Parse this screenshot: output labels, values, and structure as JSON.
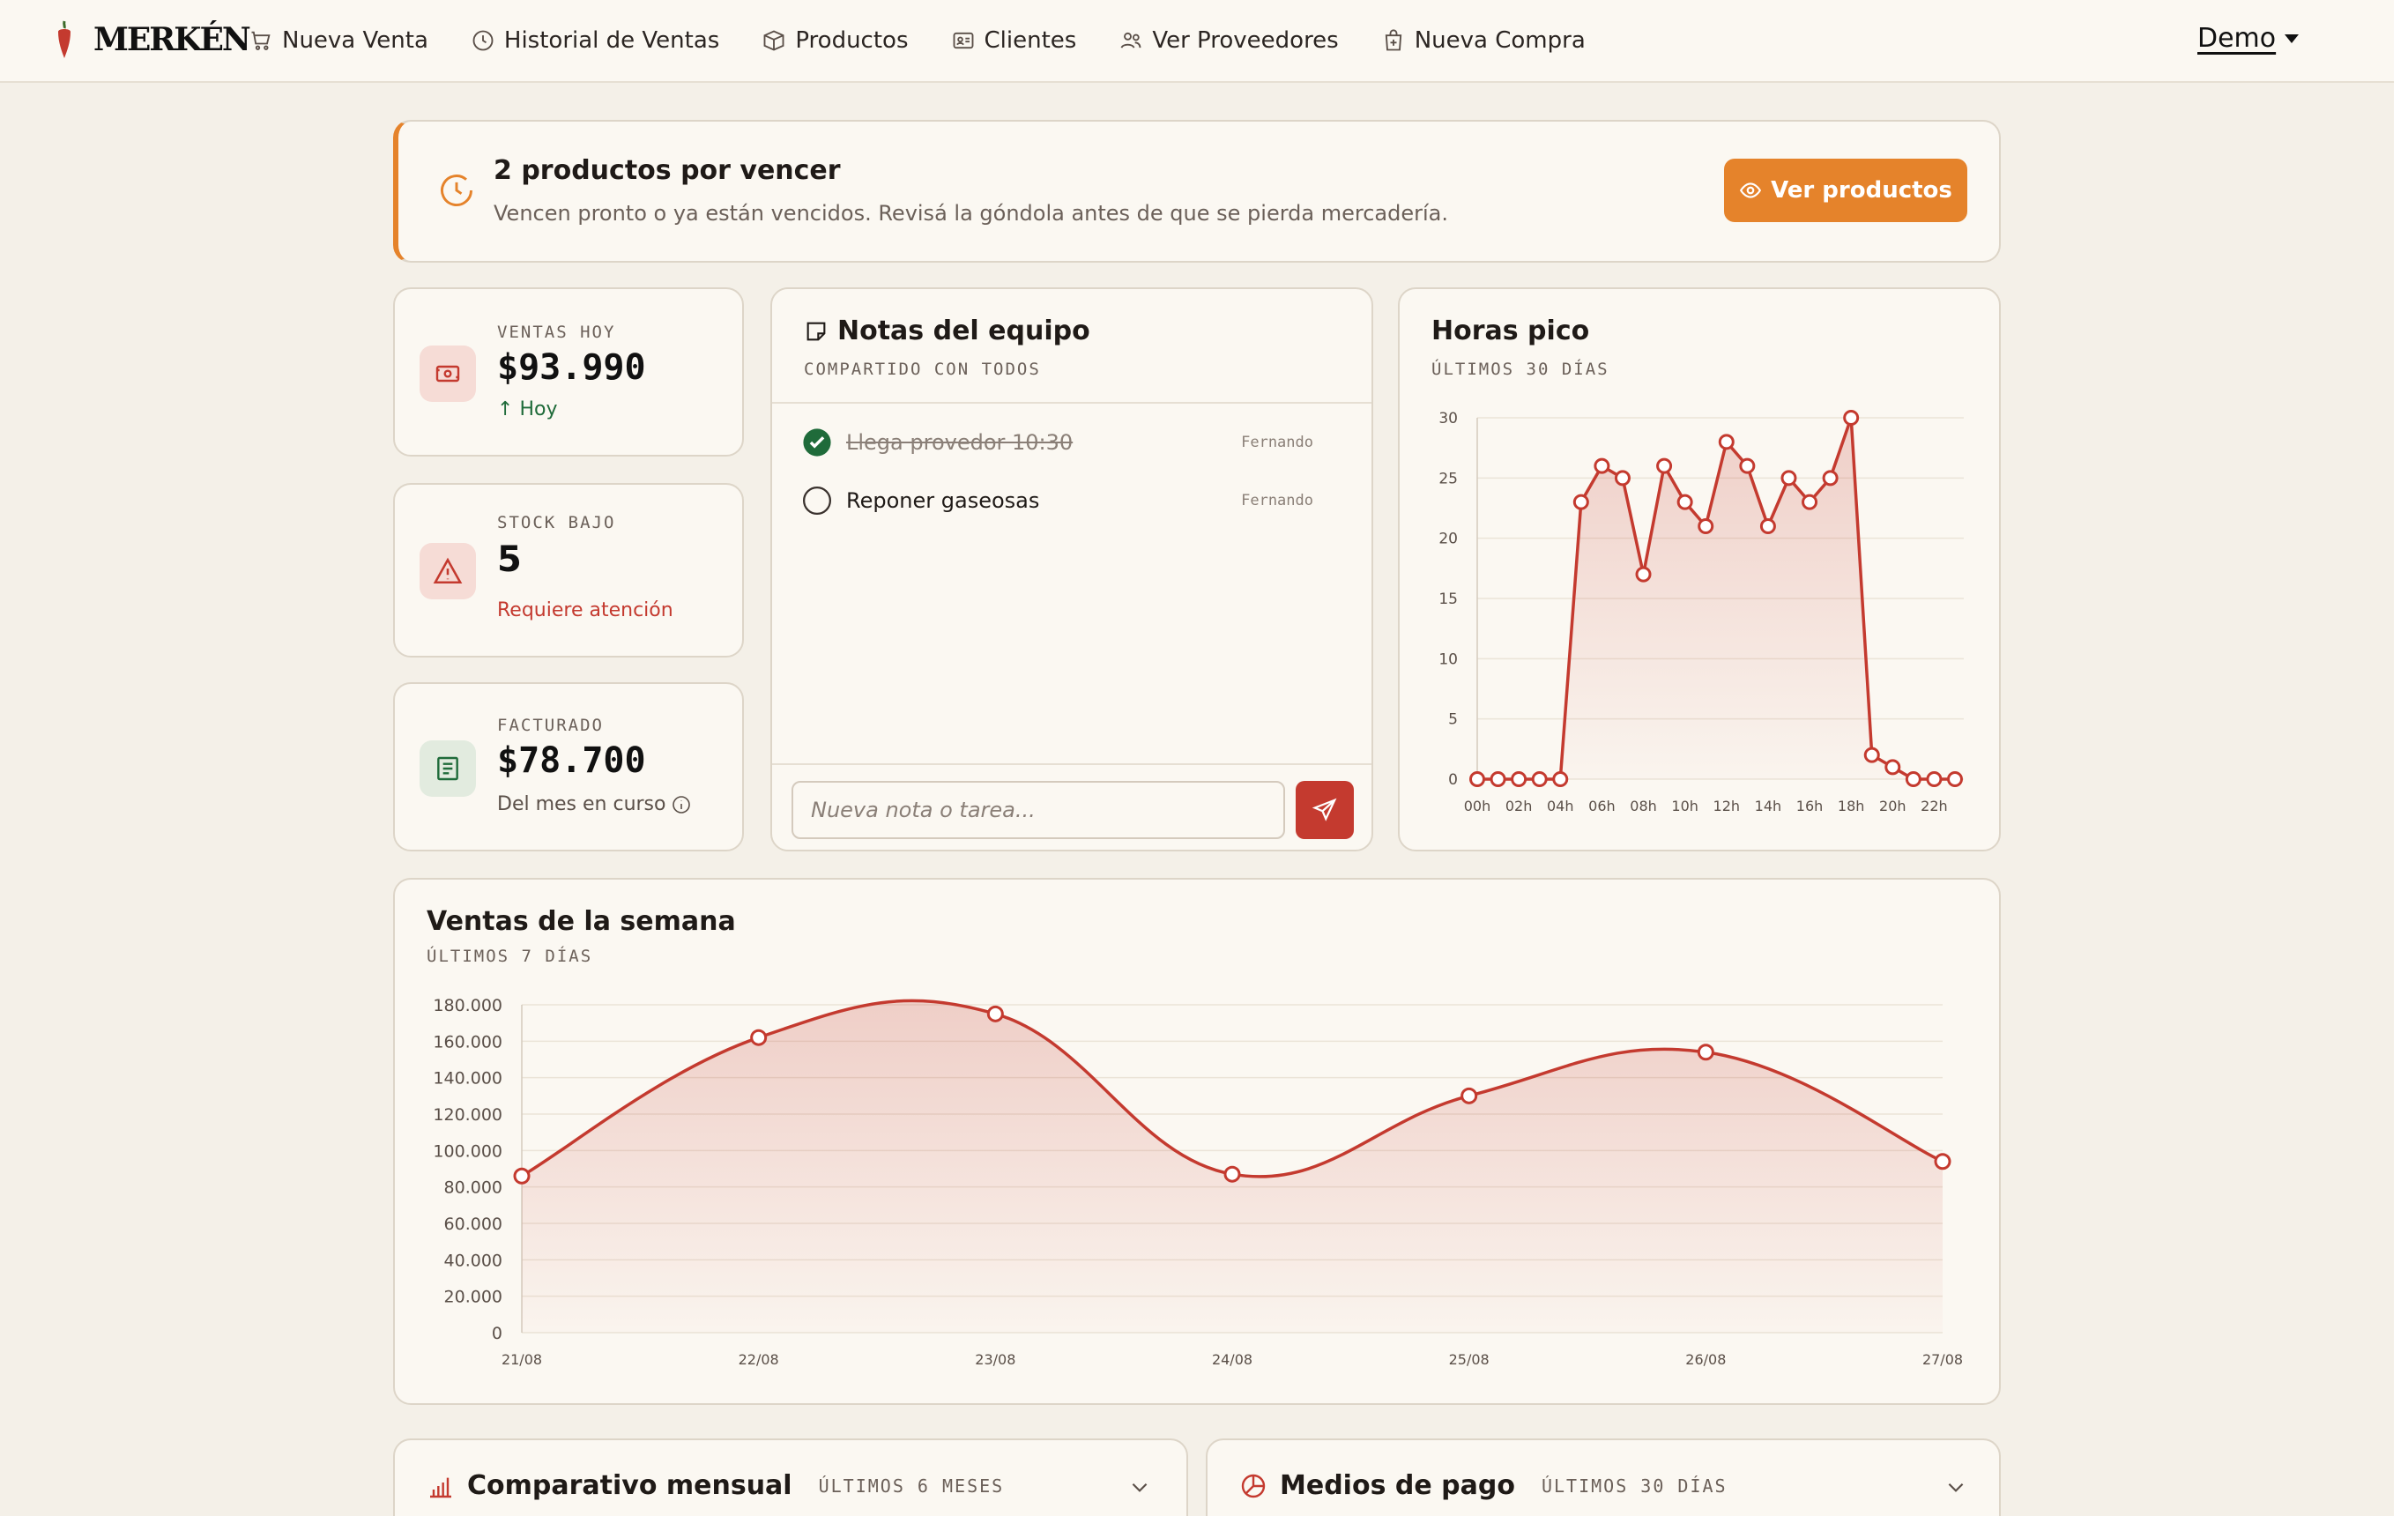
{
  "app": {
    "brand": "MERKÉN",
    "user": "Demo"
  },
  "nav": [
    {
      "label": "Nueva Venta",
      "icon": "cart-icon"
    },
    {
      "label": "Historial de Ventas",
      "icon": "clock-icon"
    },
    {
      "label": "Productos",
      "icon": "box-icon"
    },
    {
      "label": "Clientes",
      "icon": "id-card-icon"
    },
    {
      "label": "Ver Proveedores",
      "icon": "users-icon"
    },
    {
      "label": "Nueva Compra",
      "icon": "shopping-bag-icon"
    }
  ],
  "alert": {
    "title": "2 productos por vencer",
    "subtitle": "Vencen pronto o ya están vencidos. Revisá la góndola antes de que se pierda mercadería.",
    "button": "Ver productos"
  },
  "stats": {
    "sales_today": {
      "label": "VENTAS HOY",
      "value": "$93.990",
      "foot": "Hoy"
    },
    "low_stock": {
      "label": "STOCK BAJO",
      "value": "5",
      "foot": "Requiere atención"
    },
    "billed": {
      "label": "FACTURADO",
      "value": "$78.700",
      "foot": "Del mes en curso"
    }
  },
  "notes": {
    "title": "Notas del equipo",
    "subtitle": "COMPARTIDO CON TODOS",
    "items": [
      {
        "text": "Llega provedor 10:30",
        "author": "Fernando",
        "done": true
      },
      {
        "text": "Reponer gaseosas",
        "author": "Fernando",
        "done": false
      }
    ],
    "input_placeholder": "Nueva nota o tarea..."
  },
  "peak_hours": {
    "title": "Horas pico",
    "subtitle": "ÚLTIMOS 30 DÍAS"
  },
  "weekly": {
    "title": "Ventas de la semana",
    "subtitle": "ÚLTIMOS 7 DÍAS"
  },
  "monthly": {
    "title": "Comparativo mensual",
    "subtitle": "ÚLTIMOS 6 MESES"
  },
  "payments": {
    "title": "Medios de pago",
    "subtitle": "ÚLTIMOS 30 DÍAS"
  },
  "colors": {
    "accent": "#c43a2f",
    "warning": "#e5832b",
    "success": "#1f6b3a"
  },
  "chart_data": [
    {
      "type": "line",
      "x": [
        "00h",
        "01h",
        "02h",
        "03h",
        "04h",
        "05h",
        "06h",
        "07h",
        "08h",
        "09h",
        "10h",
        "11h",
        "12h",
        "13h",
        "14h",
        "15h",
        "16h",
        "17h",
        "18h",
        "19h",
        "20h",
        "21h",
        "22h",
        "23h"
      ],
      "tick_labels": [
        "00h",
        "02h",
        "04h",
        "06h",
        "08h",
        "10h",
        "12h",
        "14h",
        "16h",
        "18h",
        "20h",
        "22h"
      ],
      "values": [
        0,
        0,
        0,
        0,
        0,
        23,
        26,
        25,
        17,
        26,
        23,
        21,
        28,
        26,
        21,
        25,
        23,
        25,
        30,
        2,
        1,
        0,
        0,
        0
      ],
      "ylim": [
        0,
        30
      ],
      "yticks": [
        0,
        5,
        10,
        15,
        20,
        25,
        30
      ],
      "grid": true
    },
    {
      "type": "area",
      "x": [
        "21/08",
        "22/08",
        "23/08",
        "24/08",
        "25/08",
        "26/08",
        "27/08"
      ],
      "values": [
        86000,
        162000,
        175000,
        87000,
        130000,
        154000,
        94000
      ],
      "ylim": [
        0,
        180000
      ],
      "yticks": [
        "0",
        "20.000",
        "40.000",
        "60.000",
        "80.000",
        "100.000",
        "120.000",
        "140.000",
        "160.000",
        "180.000"
      ],
      "grid": true
    }
  ]
}
